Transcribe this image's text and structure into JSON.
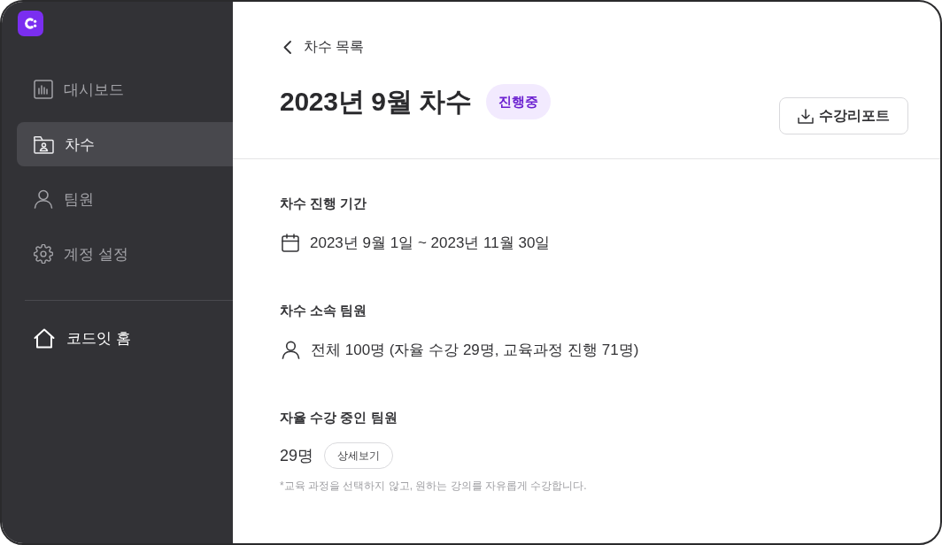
{
  "sidebar": {
    "items": [
      {
        "label": "대시보드",
        "selected": false
      },
      {
        "label": "차수",
        "selected": true
      },
      {
        "label": "팀원",
        "selected": false
      },
      {
        "label": "계정 설정",
        "selected": false
      }
    ],
    "home_link": {
      "label": "코드잇 홈"
    }
  },
  "header": {
    "back_link": "차수 목록",
    "title": "2023년 9월 차수",
    "status_badge": "진행중",
    "report_button": "수강리포트"
  },
  "sections": [
    {
      "kind": "period",
      "heading": "차수 진행 기간",
      "value": "2023년 9월 1일 ~ 2023년 11월 30일"
    },
    {
      "kind": "members",
      "heading": "차수 소속 팀원",
      "value": "전체 100명 (자율 수강 29명, 교육과정 진행 71명)"
    },
    {
      "kind": "count",
      "heading": "자율 수강 중인 팀원",
      "value": "29명",
      "button": "상세보기",
      "note": "*교육 과정을 선택하지 않고, 원하는 강의를 자유롭게 수강합니다."
    }
  ]
}
